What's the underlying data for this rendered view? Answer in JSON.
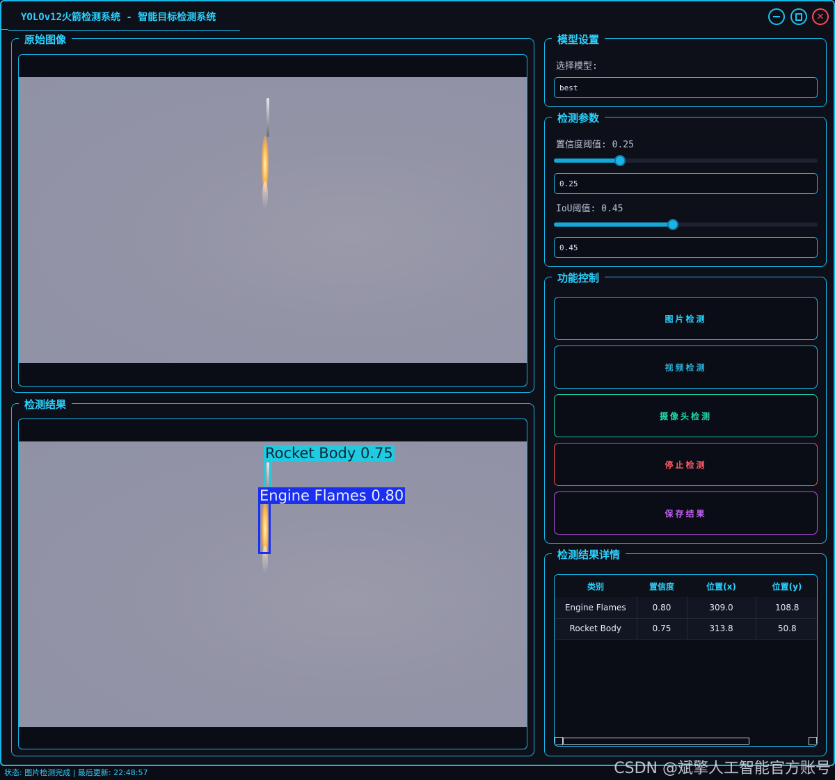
{
  "window": {
    "title": "YOLOv12火箭检测系统 - 智能目标检测系统",
    "minimize_icon": "minimize-icon",
    "maximize_icon": "maximize-icon",
    "close_icon": "close-icon",
    "accent": "#16b8e8"
  },
  "original_panel": {
    "title": "原始图像"
  },
  "result_panel": {
    "title": "检测结果",
    "detections_drawn": [
      {
        "label": "Rocket Body 0.75",
        "color": "#1ecbe1"
      },
      {
        "label": "Engine Flames 0.80",
        "color": "#1a2ff0"
      }
    ]
  },
  "model_settings": {
    "title": "模型设置",
    "select_label": "选择模型:",
    "selected_model": "best"
  },
  "detection_params": {
    "title": "检测参数",
    "confidence_label": "置信度阈值: 0.25",
    "confidence_value": "0.25",
    "confidence_fraction": 0.25,
    "iou_label": "IoU阈值: 0.45",
    "iou_value": "0.45",
    "iou_fraction": 0.45
  },
  "controls": {
    "title": "功能控制",
    "image_detect": "图片检测",
    "video_detect": "视频检测",
    "camera_detect": "摄像头检测",
    "stop_detect": "停止检测",
    "save_result": "保存结果",
    "colors": {
      "image": "#16b8e8",
      "video": "#16b8e8",
      "camera": "#18c9a0",
      "stop": "#ff4a5a",
      "save": "#b450e8"
    }
  },
  "details": {
    "title": "检测结果详情",
    "columns": [
      "类别",
      "置信度",
      "位置(x)",
      "位置(y)"
    ],
    "rows": [
      [
        "Engine Flames",
        "0.80",
        "309.0",
        "108.8"
      ],
      [
        "Rocket Body",
        "0.75",
        "313.8",
        "50.8"
      ]
    ]
  },
  "status": {
    "text": "状态: 图片检测完成 | 最后更新: 22:48:57"
  },
  "watermark": "CSDN @斌擎人工智能官方账号"
}
